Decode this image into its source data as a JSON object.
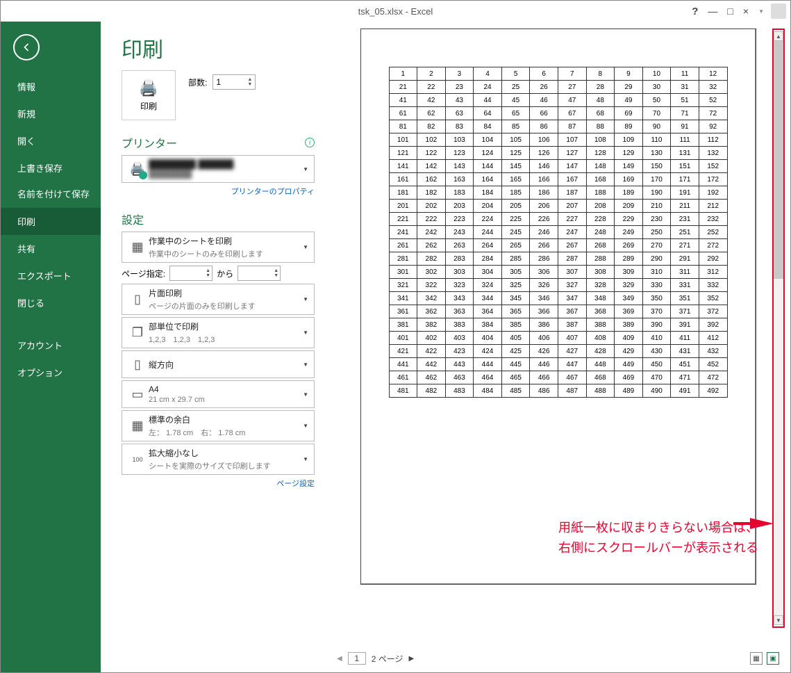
{
  "titlebar": {
    "title": "tsk_05.xlsx - Excel",
    "help": "?",
    "min": "—",
    "max": "□",
    "close": "×"
  },
  "sidebar": {
    "items": [
      {
        "label": "情報"
      },
      {
        "label": "新規"
      },
      {
        "label": "開く"
      },
      {
        "label": "上書き保存"
      },
      {
        "label": "名前を付けて保存"
      },
      {
        "label": "印刷"
      },
      {
        "label": "共有"
      },
      {
        "label": "エクスポート"
      },
      {
        "label": "閉じる"
      },
      {
        "label": "アカウント"
      },
      {
        "label": "オプション"
      }
    ],
    "active_index": 5
  },
  "page": {
    "title": "印刷"
  },
  "print_button": {
    "label": "印刷"
  },
  "copies": {
    "label": "部数:",
    "value": "1"
  },
  "printer": {
    "section": "プリンター",
    "name": "████████ ██████",
    "status": "████████",
    "properties_link": "プリンターのプロパティ"
  },
  "settings": {
    "section": "設定",
    "sheet": {
      "title": "作業中のシートを印刷",
      "sub": "作業中のシートのみを印刷します"
    },
    "pages": {
      "label": "ページ指定:",
      "from": "",
      "to_label": "から",
      "to": ""
    },
    "sides": {
      "title": "片面印刷",
      "sub": "ページの片面のみを印刷します"
    },
    "collate": {
      "title": "部単位で印刷",
      "sub": "1,2,3　1,2,3　1,2,3"
    },
    "orientation": {
      "title": "縦方向"
    },
    "paper": {
      "title": "A4",
      "sub": "21 cm x 29.7 cm"
    },
    "margins": {
      "title": "標準の余白",
      "sub": "左： 1.78 cm　右： 1.78 cm"
    },
    "scaling": {
      "title": "拡大縮小なし",
      "sub": "シートを実際のサイズで印刷します"
    },
    "page_setup_link": "ページ設定"
  },
  "preview_nav": {
    "current": "1",
    "total_label": "2 ページ"
  },
  "annotation": {
    "line1": "用紙一枚に収まりきらない場合は、",
    "line2": "右側にスクロールバーが表示される"
  },
  "chart_data": {
    "type": "table",
    "title": "Print preview grid",
    "rows": 25,
    "cols": 12,
    "row_step": 20,
    "description": "cell(r,c) = r*20 + (c+1) for r in 0..24, c in 0..11",
    "first_row": [
      1,
      2,
      3,
      4,
      5,
      6,
      7,
      8,
      9,
      10,
      11,
      12
    ],
    "last_row": [
      481,
      482,
      483,
      484,
      485,
      486,
      487,
      488,
      489,
      490,
      491,
      492
    ]
  }
}
